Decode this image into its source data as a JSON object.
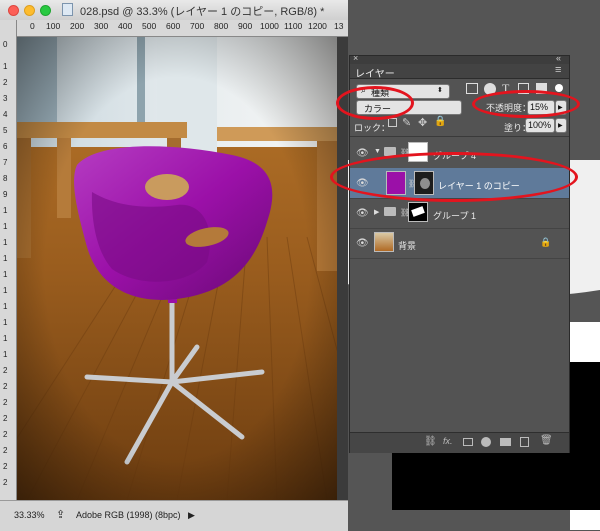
{
  "document": {
    "title": "028.psd @ 33.3% (レイヤー 1 のコピー, RGB/8) *",
    "ruler_top": [
      "0",
      "100",
      "200",
      "300",
      "400",
      "500",
      "600",
      "700",
      "800",
      "900",
      "1000",
      "1100",
      "1200",
      "13"
    ],
    "ruler_left": [
      "0",
      "1",
      "2",
      "3",
      "4",
      "5",
      "6",
      "7",
      "8",
      "9",
      "1",
      "1",
      "1",
      "1",
      "1",
      "1",
      "1",
      "1",
      "1",
      "1",
      "2",
      "2",
      "2",
      "2",
      "2",
      "2",
      "2",
      "2"
    ],
    "zoom": "33.33%",
    "color_profile": "Adobe RGB (1998) (8bpc)",
    "status_arrow": "▶"
  },
  "panel": {
    "title": "レイヤー",
    "close_glyph": "×",
    "menu_glyph": "≡",
    "collapse_glyph": "«",
    "filter_kind": "種類",
    "blend_mode": "カラー",
    "opacity_label": "不透明度：",
    "opacity_value": "15%",
    "lock_label": "ロック：",
    "fill_label": "塗り：",
    "fill_value": "100%",
    "layers": [
      {
        "name": "グループ 4",
        "type": "group",
        "expanded": true
      },
      {
        "name": "レイヤー 1 のコピー",
        "type": "layer",
        "selected": true
      },
      {
        "name": "グループ 1",
        "type": "group",
        "expanded": false
      },
      {
        "name": "背景",
        "type": "background",
        "locked": true
      }
    ],
    "footer_icons": [
      "link-icon",
      "fx-icon",
      "mask-icon",
      "adjustment-icon",
      "folder-icon",
      "new-layer-icon",
      "trash-icon"
    ],
    "fx_label": "fx."
  },
  "colors": {
    "chair": "#9b10a8",
    "selected_row": "#5f7a9a",
    "annotation": "#e3141e"
  }
}
